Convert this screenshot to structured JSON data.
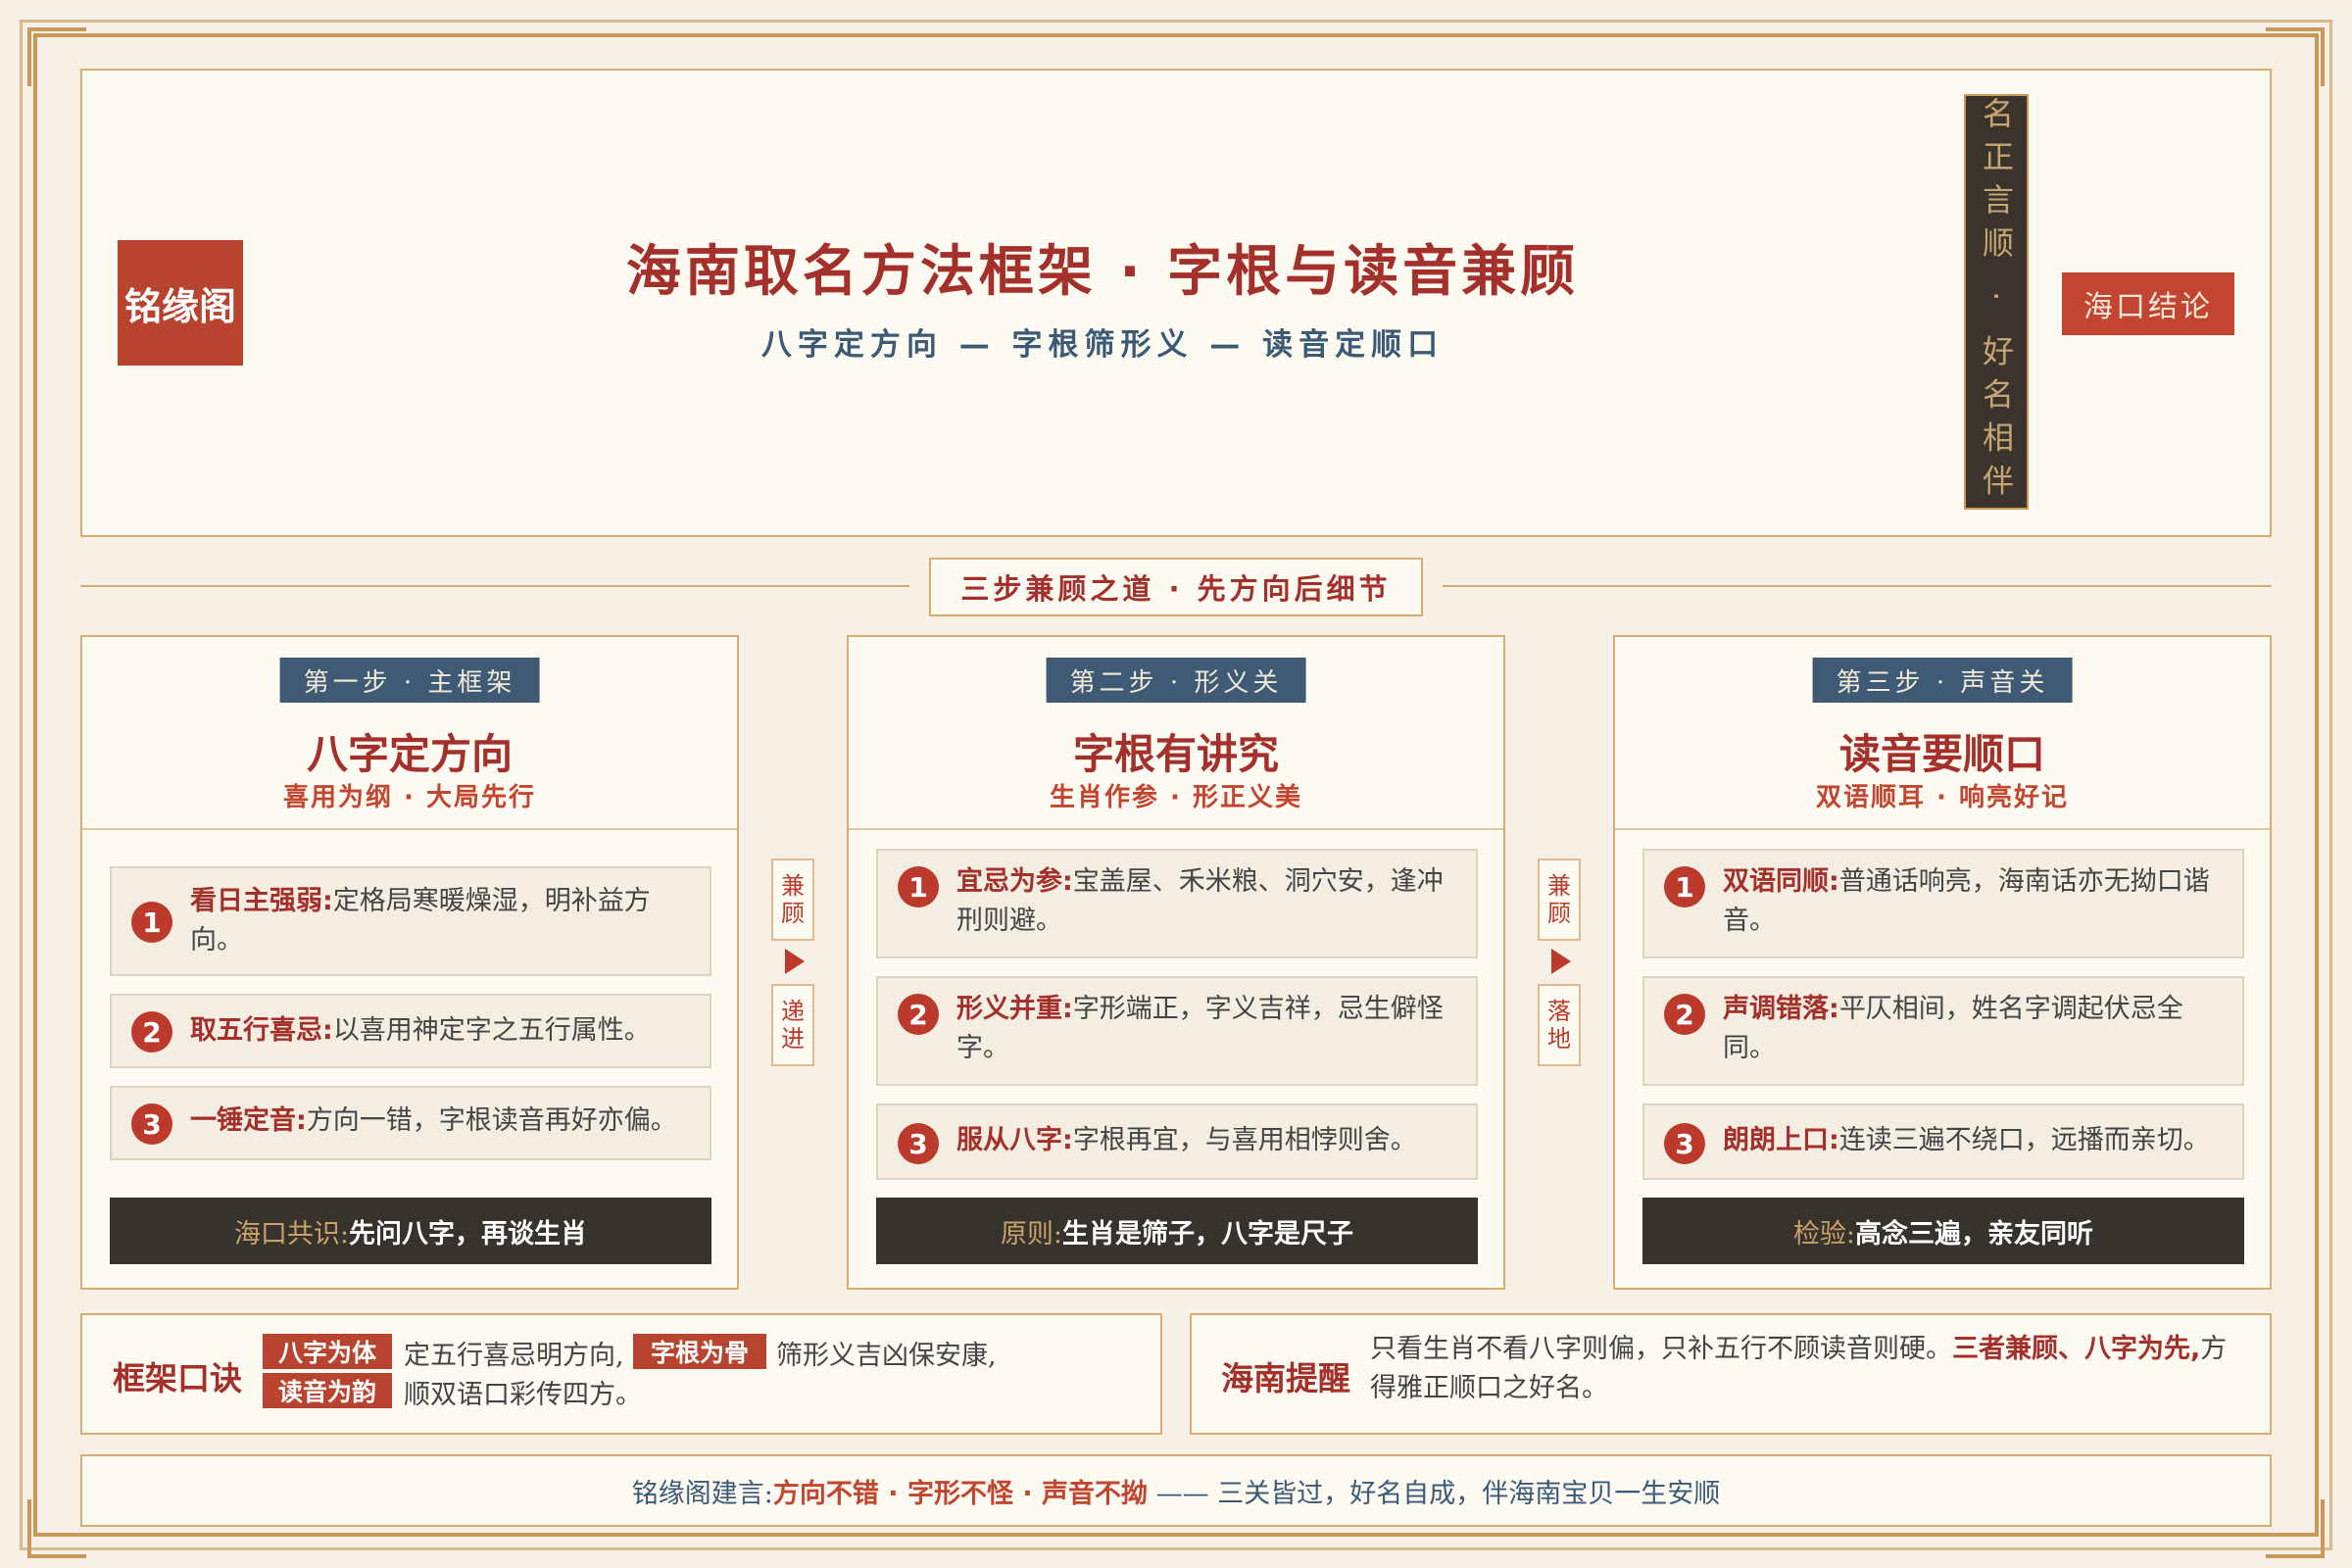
{
  "brand": "铭缘阁",
  "header": {
    "title": "海南取名方法框架 · 字根与读音兼顾",
    "subtitle": "八字定方向 — 字根筛形义 — 读音定顺口",
    "vertical_band": "名正言顺 · 好名相伴",
    "conclusion_badge": "海口结论"
  },
  "divider": {
    "label": "三步兼顾之道 · 先方向后细节"
  },
  "steps": [
    {
      "tag": "第一步 · 主框架",
      "title": "八字定方向",
      "subtitle": "喜用为纲 · 大局先行",
      "items": [
        {
          "num": "1",
          "head": "看日主强弱:",
          "text": "定格局寒暖燥湿，明补益方向。"
        },
        {
          "num": "2",
          "head": "取五行喜忌:",
          "text": "以喜用神定字之五行属性。"
        },
        {
          "num": "3",
          "head": "一锤定音:",
          "text": "方向一错，字根读音再好亦偏。"
        }
      ],
      "footer_label": "海口共识:",
      "footer_value": "先问八字，再谈生肖"
    },
    {
      "tag": "第二步 · 形义关",
      "title": "字根有讲究",
      "subtitle": "生肖作参 · 形正义美",
      "items": [
        {
          "num": "1",
          "head": "宜忌为参:",
          "text": "宝盖屋、禾米粮、洞穴安，逢冲刑则避。"
        },
        {
          "num": "2",
          "head": "形义并重:",
          "text": "字形端正，字义吉祥，忌生僻怪字。"
        },
        {
          "num": "3",
          "head": "服从八字:",
          "text": "字根再宜，与喜用相悖则舍。"
        }
      ],
      "footer_label": "原则:",
      "footer_value": "生肖是筛子，八字是尺子"
    },
    {
      "tag": "第三步 · 声音关",
      "title": "读音要顺口",
      "subtitle": "双语顺耳 · 响亮好记",
      "items": [
        {
          "num": "1",
          "head": "双语同顺:",
          "text": "普通话响亮，海南话亦无拗口谐音。"
        },
        {
          "num": "2",
          "head": "声调错落:",
          "text": "平仄相间，姓名字调起伏忌全同。"
        },
        {
          "num": "3",
          "head": "朗朗上口:",
          "text": "连读三遍不绕口，远播而亲切。"
        }
      ],
      "footer_label": "检验:",
      "footer_value": "高念三遍，亲友同听"
    }
  ],
  "connectors": [
    {
      "top": "兼顾",
      "bottom": "递进"
    },
    {
      "top": "兼顾",
      "bottom": "落地"
    }
  ],
  "formula": {
    "title": "框架口诀",
    "chip1": "八字为体",
    "text1": "定五行喜忌明方向,",
    "chip2": "字根为骨",
    "text2": "筛形义吉凶保安康,",
    "chip3": "读音为韵",
    "text3": "顺双语口彩传四方。"
  },
  "hainan_tip": {
    "title": "海南提醒",
    "text_a": "只看生肖不看八字则偏，只补五行不顾读音则硬。",
    "text_b": "三者兼顾、八字为先,",
    "text_c": "方得雅正顺口之好名。"
  },
  "motto": {
    "lead": "铭缘阁建言:",
    "highlight": "方向不错 · 字形不怪 · 声音不拗",
    "tail": "—— 三关皆过，好名自成，伴海南宝贝一生安顺"
  },
  "colors": {
    "accent_red": "#a3302a",
    "navy": "#3e5a74",
    "gold": "#c9995a",
    "dark": "#37322c",
    "cream": "#fdfaf2"
  }
}
